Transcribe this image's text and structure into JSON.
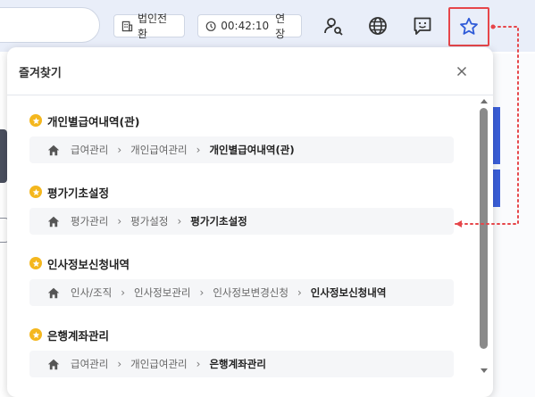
{
  "header": {
    "corp_switch_label": "법인전환",
    "timer_value": "00:42:10",
    "extend_label": "연장",
    "icons": [
      "building-icon",
      "clock-icon",
      "user-search-icon",
      "globe-icon",
      "chat-icon",
      "star-icon"
    ]
  },
  "favorites": {
    "title": "즐겨찾기",
    "items": [
      {
        "name": "개인별급여내역(관)",
        "path": [
          "급여관리",
          "개인급여관리",
          "개인별급여내역(관)"
        ]
      },
      {
        "name": "평가기초설정",
        "path": [
          "평가관리",
          "평가설정",
          "평가기초설정"
        ]
      },
      {
        "name": "인사정보신청내역",
        "path": [
          "인사/조직",
          "인사정보관리",
          "인사정보변경신청",
          "인사정보신청내역"
        ]
      },
      {
        "name": "은행계좌관리",
        "path": [
          "급여관리",
          "개인급여관리",
          "은행계좌관리"
        ]
      }
    ]
  },
  "colors": {
    "accent": "#3b5fd9",
    "highlight_border": "#e6464a",
    "star_badge": "#f4b71e"
  }
}
